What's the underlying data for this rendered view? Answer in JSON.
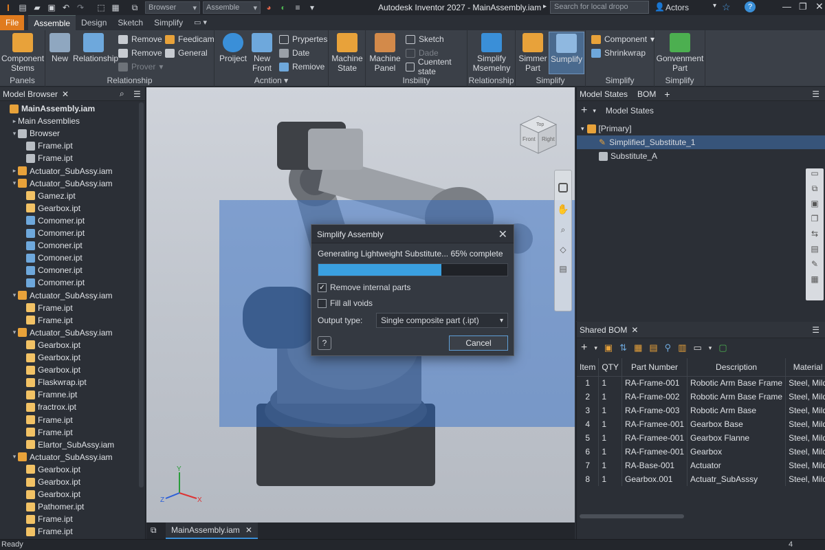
{
  "title_bar": {
    "app_title": "Autodesk Inventor 2027 - MainAssembly.iam",
    "combo1": "Browser",
    "combo2": "Assemble",
    "search_placeholder": "Search for local dropo",
    "user": "Actors"
  },
  "ribbon_tabs": [
    "File",
    "Assemble",
    "Design",
    "Sketch",
    "Simplify"
  ],
  "ribbon": {
    "panels": {
      "p1_label": "Panels",
      "p2_label": "Relationship",
      "p3_label": "Acntion",
      "p4_label": "Insbility",
      "p5_label": "Relationship",
      "p6_label": "Simplify",
      "p7_label": "Simplify",
      "p8_label": "Simplify"
    },
    "component_stems": "Component\nStems",
    "new": "New",
    "relationship": "Relationship",
    "remove1": "Remove",
    "remove2": "Remove",
    "prover": "Prover",
    "feedicam": "Feedicam",
    "general": "General",
    "project": "Proiject",
    "new_front": "New\nFront",
    "prypertes": "Prypertes",
    "date": "Date",
    "remiove": "Remiove",
    "machine_state": "Machine\nState",
    "machine_panel": "Machine\nPanel",
    "sketch": "Sketch",
    "dade": "Dade",
    "cuentent_state": "Cuentent state",
    "simplify_msemelny": "Simplify\nMsemelny",
    "simmer_part": "Simmer\nPart",
    "sumplify": "Sumplify",
    "component": "Component",
    "shrinkwrap": "Shrinkwrap",
    "gonvenment_part": "Gonvenment\nPart"
  },
  "model_browser": {
    "title": "Model Browser",
    "rows": [
      {
        "label": "MainAssembly.iam",
        "icon": "assembly"
      },
      {
        "label": "Main Assemblies",
        "icon": "none"
      },
      {
        "label": "Browser",
        "icon": "folder"
      },
      {
        "label": "Frame.ipt",
        "icon": "grey"
      },
      {
        "label": "Frame.ipt",
        "icon": "grey"
      },
      {
        "label": "Actuator_SubAssy.iam",
        "icon": "assembly"
      },
      {
        "label": "Actuator_SubAssy.iam",
        "icon": "assembly"
      },
      {
        "label": "Gamez.ipt",
        "icon": "part"
      },
      {
        "label": "Gearbox.ipt",
        "icon": "part"
      },
      {
        "label": "Comomer.ipt",
        "icon": "blue"
      },
      {
        "label": "Comomer.ipt",
        "icon": "blue"
      },
      {
        "label": "Comoner.ipt",
        "icon": "blue"
      },
      {
        "label": "Comoner.ipt",
        "icon": "blue"
      },
      {
        "label": "Comoner.ipt",
        "icon": "blue"
      },
      {
        "label": "Comomer.ipt",
        "icon": "blue"
      },
      {
        "label": "Actuator_SubAssy.iam",
        "icon": "assembly"
      },
      {
        "label": "Frame.ipt",
        "icon": "part"
      },
      {
        "label": "Frame.ipt",
        "icon": "part"
      },
      {
        "label": "Actuator_SubAssy.iam",
        "icon": "assembly"
      },
      {
        "label": "Gearbox.ipt",
        "icon": "part"
      },
      {
        "label": "Gearbox.ipt",
        "icon": "part"
      },
      {
        "label": "Gearbox.ipt",
        "icon": "part"
      },
      {
        "label": "Flaskwrap.ipt",
        "icon": "part"
      },
      {
        "label": "Framne.ipt",
        "icon": "part"
      },
      {
        "label": "fractrox.ipt",
        "icon": "part"
      },
      {
        "label": "Frame.ipt",
        "icon": "part"
      },
      {
        "label": "Frame.ipt",
        "icon": "part"
      },
      {
        "label": "Elartor_SubAssy.iam",
        "icon": "part"
      },
      {
        "label": "Actuator_SubAssy.iam",
        "icon": "assembly"
      },
      {
        "label": "Gearbox.ipt",
        "icon": "part"
      },
      {
        "label": "Gearbox.ipt",
        "icon": "part"
      },
      {
        "label": "Gearbox.ipt",
        "icon": "part"
      },
      {
        "label": "Pathomer.ipt",
        "icon": "part"
      },
      {
        "label": "Frame.ipt",
        "icon": "part"
      },
      {
        "label": "Frame.ipt",
        "icon": "part"
      }
    ]
  },
  "viewcube": {
    "top": "Top",
    "front": "Front",
    "right": "Right"
  },
  "triad": {
    "x": "X",
    "y": "Y",
    "z": "Z"
  },
  "dialog": {
    "title": "Simplify Assembly",
    "status": "Generating Lightweight Substitute... 65% complete",
    "progress": 0.65,
    "remove_internal": "Remove internal parts",
    "fill_voids": "Fill all voids",
    "output_label": "Output type:",
    "output_value": "Single composite part (.ipt)",
    "cancel": "Cancel"
  },
  "model_states": {
    "tab1": "Model States",
    "tab2": "BOM",
    "header": "Model States",
    "rows": [
      "[Primary]",
      "Simplified_Substitute_1",
      "Substitute_A"
    ]
  },
  "bom": {
    "title": "Shared BOM",
    "columns": [
      "Item",
      "QTY",
      "Part Number",
      "Description",
      "Material"
    ],
    "rows": [
      [
        "1",
        "1",
        "RA-Frame-001",
        "Robotic Arm Base Frame",
        "Steel, Mild"
      ],
      [
        "2",
        "1",
        "RA-Frame-002",
        "Robotic Arm Base Frame",
        "Steel, Mild"
      ],
      [
        "3",
        "1",
        "RA-Frame-003",
        "Robotic Arm Base",
        "Steel, Mild"
      ],
      [
        "4",
        "1",
        "RA-Framee-001",
        "Gearbox Base",
        "Steel, Mild"
      ],
      [
        "5",
        "1",
        "RA-Framee-001",
        "Gearbox Flanne",
        "Steel, Mild"
      ],
      [
        "6",
        "1",
        "RA-Framee-001",
        "Gearbox",
        "Steel, Mild"
      ],
      [
        "7",
        "1",
        "RA-Base-001",
        "Actuator",
        "Steel, Mild"
      ],
      [
        "8",
        "1",
        "Gearbox.001",
        "Actuatr_SubAsssy",
        "Steel, Mild"
      ]
    ]
  },
  "doc_tab": "MainAssembly.iam",
  "status_bar": {
    "left": "Ready",
    "count": "4"
  },
  "colors": {
    "accent": "#e07b1e",
    "progress": "#3aa0e0",
    "selection": "#2f5a8a"
  }
}
